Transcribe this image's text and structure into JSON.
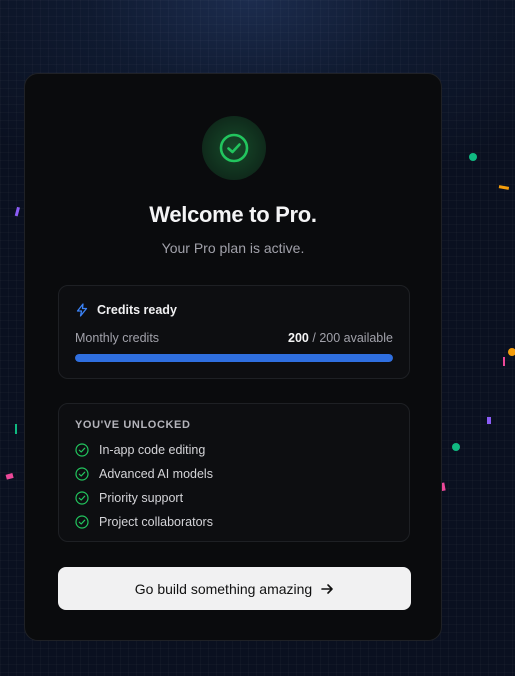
{
  "header": {
    "title": "Welcome to Pro.",
    "subtitle": "Your Pro plan is active."
  },
  "credits": {
    "title": "Credits ready",
    "label": "Monthly credits",
    "current": "200",
    "suffix": "/ 200 available",
    "fill_fraction": 1.0
  },
  "unlocked": {
    "heading": "YOU'VE UNLOCKED",
    "features": [
      "In-app code editing",
      "Advanced AI models",
      "Priority support",
      "Project collaborators"
    ]
  },
  "cta": {
    "label": "Go build something amazing"
  },
  "icons": {
    "badge": "check-circle-icon",
    "credits": "lightning-icon",
    "feature": "check-circle-icon",
    "cta": "arrow-right-icon"
  },
  "colors": {
    "accent_green": "#22c55e",
    "accent_blue": "#2f6fe0",
    "card_bg": "#0a0b0d"
  }
}
